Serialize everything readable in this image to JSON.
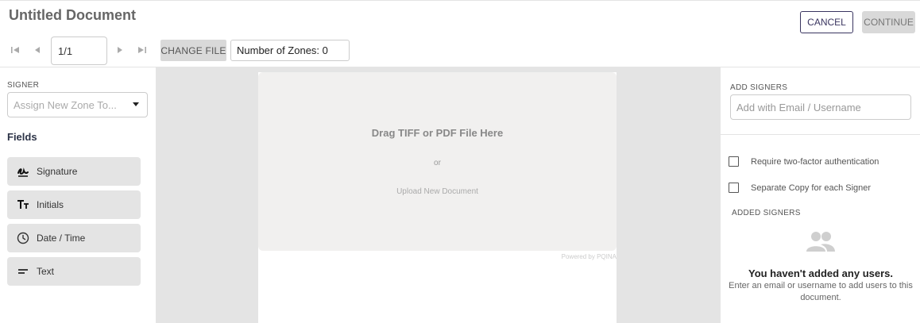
{
  "header": {
    "title": "Untitled Document",
    "page_value": "1/1",
    "change_file_label": "CHANGE FILE",
    "zones_label": "Number of Zones: 0",
    "cancel_label": "CANCEL",
    "continue_label": "CONTINUE"
  },
  "left": {
    "signer_label": "SIGNER",
    "signer_placeholder": "Assign New Zone To...",
    "fields_title": "Fields",
    "fields": [
      {
        "label": "Signature",
        "icon": "signature-icon"
      },
      {
        "label": "Initials",
        "icon": "text-size-icon"
      },
      {
        "label": "Date / Time",
        "icon": "clock-icon"
      },
      {
        "label": "Text",
        "icon": "text-lines-icon"
      }
    ]
  },
  "center": {
    "drop_main": "Drag TIFF or PDF File Here",
    "drop_or": "or",
    "drop_upload": "Upload New Document",
    "powered": "Powered by PQINA"
  },
  "right": {
    "add_signers_label": "ADD SIGNERS",
    "add_placeholder": "Add with Email / Username",
    "two_factor_label": "Require two-factor authentication",
    "separate_copy_label": "Separate Copy for each Signer",
    "added_signers_label": "ADDED SIGNERS",
    "empty_title": "You haven't added any users.",
    "empty_sub": "Enter an email or username to add users to this document."
  },
  "colors": {
    "accent": "#3a3560",
    "panel_bg": "#e4e4e4",
    "dropzone_bg": "#f1f0ef"
  }
}
